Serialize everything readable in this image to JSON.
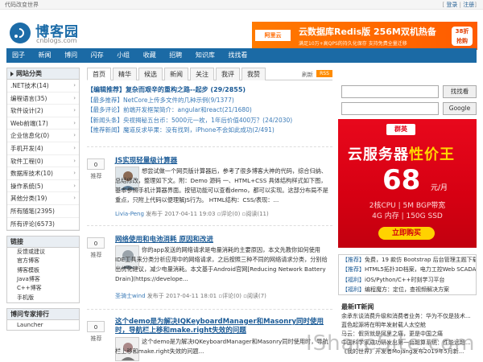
{
  "topbar": {
    "slogan": "代码改变世界",
    "login": "登录",
    "separator": "|",
    "register": "注册"
  },
  "header": {
    "logo_name": "博客园",
    "logo_domain": "cnblogs.com",
    "ad": {
      "brand": "阿里云",
      "title": "云数据库Redis版 256M双机热备",
      "subtitle": "满足10万+高QPS的持久化保存  支持免费全量迁移",
      "price": "38折 抢购"
    }
  },
  "nav": [
    "园子",
    "新闻",
    "博问",
    "闪存",
    "小组",
    "收藏",
    "招聘",
    "知识库",
    "找找看"
  ],
  "left": {
    "category_title": "网站分类",
    "categories": [
      ".NET技术(14)",
      "编程语言(35)",
      "软件设计(2)",
      "Web前端(17)",
      "企业信息化(0)",
      "手机开发(4)",
      "软件工程(0)",
      "数据库技术(10)",
      "操作系统(5)",
      "其他分类(19)",
      "所有随笔(2395)",
      "所有评论(6573)"
    ],
    "links_title": "链接",
    "links": [
      "反馈或建议",
      "官方博客",
      "博客模板",
      "Java博客",
      "C++博客",
      "手机版"
    ],
    "expert_title": "博问专家排行",
    "experts": [
      "Launcher"
    ]
  },
  "main": {
    "tabs": [
      "首页",
      "精华",
      "候选",
      "新闻",
      "关注",
      "我评",
      "我赞"
    ],
    "refresh": "刷新",
    "rss": "RSS",
    "headlines": [
      "【编辑推荐】复杂而艰辛的重构之路--起步 (29/2855)",
      "【最多推荐】NetCore上传多文件的几种示例(9/1377)",
      "【最多评论】前端开发框架简介：angular和react(21/1680)",
      "【新闻头条】央视揭秘五台币：5000元一枚，1年后价值400万？(24/2030)",
      "【推荐新闻】魔道反求毕果：没有找到，iPhone不会如此成功(2/491)"
    ],
    "posts": [
      {
        "votes": "0",
        "recommend": "推荐",
        "title": "JS实现轻量级计算器",
        "desc": "想尝试做一个网页版计算器后，参考了很多博客大神的代码，综合归纳、总结修改，整理如下文。附：Demo 源码 一、HTML+CSS 具体结构样式如下图，基本参照手机计算器界面。按钮功能可以查看demo，都可以实现。这部分布局不是重点，只附上代码以便理解JS行为。 HTML结构：CSS/表现：...",
        "author": "Livia-Peng",
        "published": "发布于 2017-04-11 19:03",
        "comments": "评论(0)",
        "views": "阅读(11)"
      },
      {
        "votes": "0",
        "recommend": "推荐",
        "title": "网络使用和电池消耗 原因和改进",
        "desc": "你的app发送的网络请求是电量消耗的主要原因，本文先教你如何使用IDE工具来分类分析应用中的网络请求，之后按照三种不同的网络请求分类，分别给出优化建议，减少电量消耗。本文基于Android官网[Reducing Network Battery Drain](https://develope...",
        "author": "圣骑士wind",
        "published": "发布于 2017-04-11 18:01",
        "comments": "评论(0)",
        "views": "阅读(7)"
      },
      {
        "votes": "0",
        "recommend": "推荐",
        "title": "这个demo是为解决IQKeyboardManager和Masonry同时使用时，导航栏上移和make.right失效的问题",
        "desc": "这个demo是为解决IQKeyboardManager和Masonry同时使用时，导航栏上移和make.right失效的问题..."
      }
    ]
  },
  "right": {
    "search_button": "找找看",
    "google_button": "Google",
    "promo": {
      "badge": "群英",
      "headline_a": "云服务器",
      "headline_b": "性价王",
      "price": "68",
      "unit": "元/月",
      "spec_line1": "2核CPU | 5M BGP带宽",
      "spec_line2": "4G 内存 | 150G SSD",
      "buy": "立即购买"
    },
    "news": [
      {
        "tag": "【推荐】",
        "text": "免费，19 款仿 Bootstrap 后台管理主题下载"
      },
      {
        "tag": "【推荐】",
        "text": "HTML5拓扑3D档案，电力工控Web SCADA"
      },
      {
        "tag": "【福利】",
        "text": "iOS/Python/C++时刻学习平台"
      },
      {
        "tag": "【福利】",
        "text": "编程魔方：定位，查视频解决方案"
      }
    ],
    "side_news_title": "最新IT新闻",
    "side_news": [
      "余承东谈消费升级和消费者业务：华为不仅是技术...",
      "蓝色起源将在明年发射载人太空舱",
      "马云：假货就是阿里之痛，更是中国之痛",
      "中国科学家成功研发出第一台超算系统：性能远超...",
      "《我的世界》开发者Mojang发布2019年5月新..."
    ]
  },
  "watermark": "IShareSite.com"
}
